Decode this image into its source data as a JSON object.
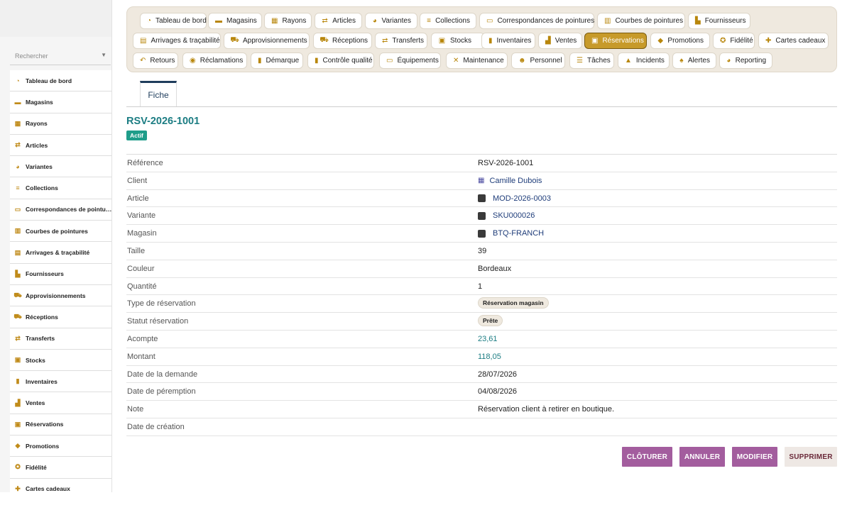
{
  "sidebar": {
    "search_placeholder": "Rechercher",
    "items": [
      {
        "label": "Tableau de bord",
        "icon": "dashboard-icon",
        "glyph": "◔"
      },
      {
        "label": "Magasins",
        "icon": "store-icon",
        "glyph": "▬"
      },
      {
        "label": "Rayons",
        "icon": "grid-icon",
        "glyph": "▦"
      },
      {
        "label": "Articles",
        "icon": "tag-icon",
        "glyph": "⇄"
      },
      {
        "label": "Variantes",
        "icon": "palette-icon",
        "glyph": "◕"
      },
      {
        "label": "Collections",
        "icon": "layers-icon",
        "glyph": "≡"
      },
      {
        "label": "Correspondances de pointures",
        "icon": "ruler-icon",
        "glyph": "▭"
      },
      {
        "label": "Courbes de pointures",
        "icon": "chart-icon",
        "glyph": "▥"
      },
      {
        "label": "Arrivages & traçabilité",
        "icon": "barcode-icon",
        "glyph": "▤"
      },
      {
        "label": "Fournisseurs",
        "icon": "factory-icon",
        "glyph": "▙"
      },
      {
        "label": "Approvisionnements",
        "icon": "cart-icon",
        "glyph": "⛟"
      },
      {
        "label": "Réceptions",
        "icon": "truck-icon",
        "glyph": "⛟"
      },
      {
        "label": "Transferts",
        "icon": "transfer-icon",
        "glyph": "⇄"
      },
      {
        "label": "Stocks",
        "icon": "box-icon",
        "glyph": "▣"
      },
      {
        "label": "Inventaires",
        "icon": "clipboard-icon",
        "glyph": "▮"
      },
      {
        "label": "Ventes",
        "icon": "register-icon",
        "glyph": "▟"
      },
      {
        "label": "Réservations",
        "icon": "calendar-check-icon",
        "glyph": "▣"
      },
      {
        "label": "Promotions",
        "icon": "tags-icon",
        "glyph": "◆"
      },
      {
        "label": "Fidélité",
        "icon": "award-icon",
        "glyph": "✪"
      },
      {
        "label": "Cartes cadeaux",
        "icon": "gift-icon",
        "glyph": "✚"
      }
    ]
  },
  "nav": {
    "active": "Réservations",
    "rows": [
      [
        {
          "label": "Tableau de bord",
          "icon": "dashboard-icon",
          "glyph": "◔"
        },
        {
          "label": "Magasins",
          "icon": "store-icon",
          "glyph": "▬"
        },
        {
          "label": "Rayons",
          "icon": "grid-icon",
          "glyph": "▦"
        },
        {
          "label": "Articles",
          "icon": "tag-icon",
          "glyph": "⇄"
        },
        {
          "label": "Variantes",
          "icon": "palette-icon",
          "glyph": "◕"
        },
        {
          "label": "Collections",
          "icon": "layers-icon",
          "glyph": "≡"
        },
        {
          "label": "Correspondances de pointures",
          "icon": "ruler-icon",
          "glyph": "▭"
        },
        {
          "label": "Courbes de pointures",
          "icon": "chart-icon",
          "glyph": "▥"
        },
        {
          "label": "Fournisseurs",
          "icon": "factory-icon",
          "glyph": "▙"
        }
      ],
      [
        {
          "label": "Arrivages & traçabilité",
          "icon": "barcode-icon",
          "glyph": "▤"
        },
        {
          "label": "Approvisionnements",
          "icon": "cart-icon",
          "glyph": "⛟"
        },
        {
          "label": "Réceptions",
          "icon": "truck-icon",
          "glyph": "⛟"
        },
        {
          "label": "Transferts",
          "icon": "transfer-icon",
          "glyph": "⇄"
        },
        {
          "label": "Stocks",
          "icon": "box-icon",
          "glyph": "▣"
        },
        {
          "label": "Inventaires",
          "icon": "clipboard-icon",
          "glyph": "▮"
        },
        {
          "label": "Ventes",
          "icon": "register-icon",
          "glyph": "▟"
        },
        {
          "label": "Réservations",
          "icon": "calendar-check-icon",
          "glyph": "▣"
        },
        {
          "label": "Promotions",
          "icon": "tags-icon",
          "glyph": "◆"
        },
        {
          "label": "Fidélité",
          "icon": "award-icon",
          "glyph": "✪"
        },
        {
          "label": "Cartes cadeaux",
          "icon": "gift-icon",
          "glyph": "✚"
        }
      ],
      [
        {
          "label": "Retours",
          "icon": "undo-icon",
          "glyph": "↶"
        },
        {
          "label": "Réclamations",
          "icon": "comment-icon",
          "glyph": "◉"
        },
        {
          "label": "Démarque",
          "icon": "clipboard-icon",
          "glyph": "▮"
        },
        {
          "label": "Contrôle qualité",
          "icon": "clipboard-check-icon",
          "glyph": "▮"
        },
        {
          "label": "Équipements",
          "icon": "monitor-icon",
          "glyph": "▭"
        },
        {
          "label": "Maintenance",
          "icon": "tools-icon",
          "glyph": "✕"
        },
        {
          "label": "Personnel",
          "icon": "users-icon",
          "glyph": "☻"
        },
        {
          "label": "Tâches",
          "icon": "list-icon",
          "glyph": "☰"
        },
        {
          "label": "Incidents",
          "icon": "warning-icon",
          "glyph": "▲"
        },
        {
          "label": "Alertes",
          "icon": "bell-icon",
          "glyph": "♠"
        },
        {
          "label": "Reporting",
          "icon": "pie-chart-icon",
          "glyph": "◕"
        }
      ]
    ]
  },
  "tab": {
    "label": "Fiche"
  },
  "record": {
    "title": "RSV-2026-1001",
    "status_badge": "Actif",
    "fields": [
      {
        "label": "Référence",
        "value": "RSV-2026-1001",
        "kind": "text"
      },
      {
        "label": "Client",
        "value": "Camille Dubois",
        "kind": "link-building"
      },
      {
        "label": "Article",
        "value": "MOD-2026-0003",
        "kind": "link-thumb"
      },
      {
        "label": "Variante",
        "value": "SKU000026",
        "kind": "link-thumb"
      },
      {
        "label": "Magasin",
        "value": "BTQ-FRANCH",
        "kind": "link-thumb"
      },
      {
        "label": "Taille",
        "value": "39",
        "kind": "text"
      },
      {
        "label": "Couleur",
        "value": "Bordeaux",
        "kind": "text"
      },
      {
        "label": "Quantité",
        "value": "1",
        "kind": "text"
      },
      {
        "label": "Type de réservation",
        "value": "Réservation magasin",
        "kind": "pill"
      },
      {
        "label": "Statut réservation",
        "value": "Prête",
        "kind": "pill"
      },
      {
        "label": "Acompte",
        "value": "23,61",
        "kind": "num"
      },
      {
        "label": "Montant",
        "value": "118,05",
        "kind": "num"
      },
      {
        "label": "Date de la demande",
        "value": "28/07/2026",
        "kind": "text"
      },
      {
        "label": "Date de péremption",
        "value": "04/08/2026",
        "kind": "text"
      },
      {
        "label": "Note",
        "value": "Réservation client à retirer en boutique.",
        "kind": "text"
      },
      {
        "label": "Date de création",
        "value": "",
        "kind": "text"
      }
    ]
  },
  "actions": [
    {
      "label": "CLÔTURER",
      "color": "#a35d9e",
      "name": "close-record-button"
    },
    {
      "label": "ANNULER",
      "color": "#a35d9e",
      "name": "cancel-button"
    },
    {
      "label": "MODIFIER",
      "color": "#a35d9e",
      "name": "edit-button"
    },
    {
      "label": "SUPPRIMER",
      "color": "#eee8e4",
      "name": "delete-button"
    }
  ],
  "colors": {
    "accent": "#c79a2a",
    "teal": "#1c7d83",
    "action": "#a35d9e"
  }
}
